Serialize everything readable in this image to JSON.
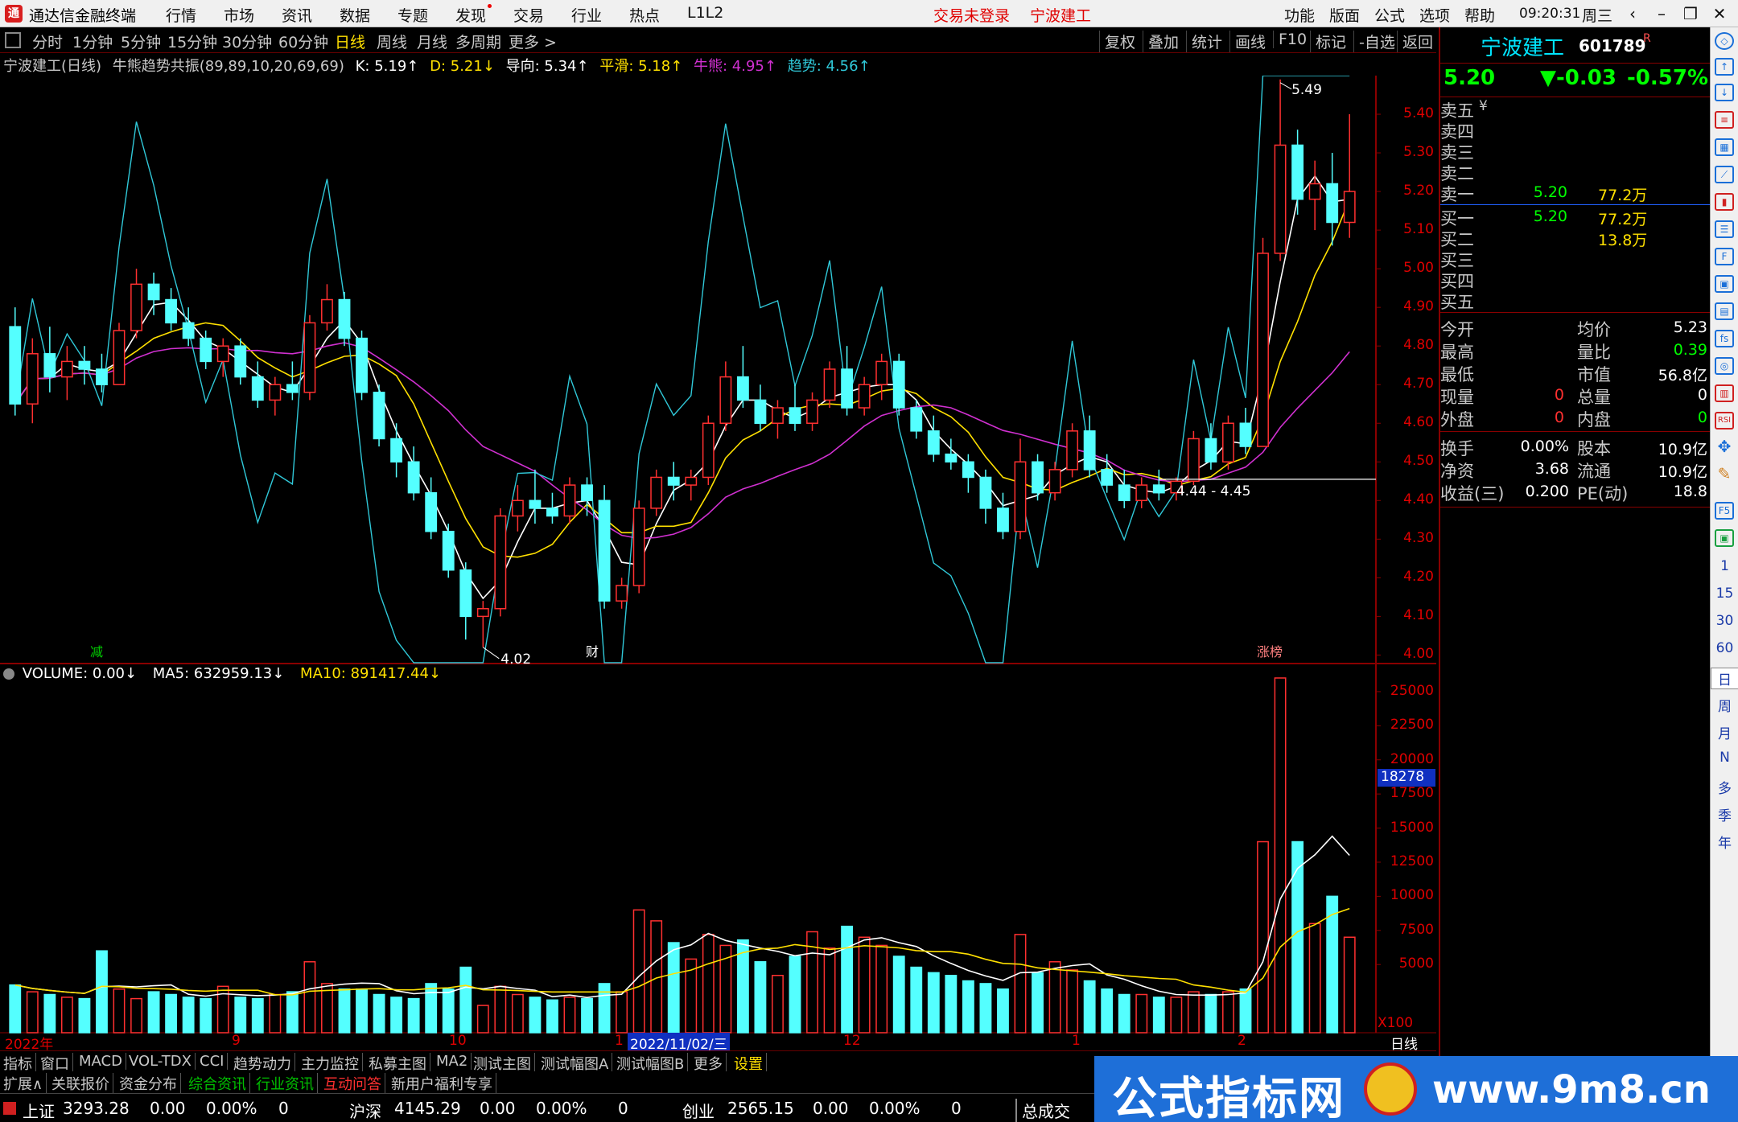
{
  "app": {
    "name": "通达信金融终端",
    "menu": [
      "行情",
      "市场",
      "资讯",
      "数据",
      "专题",
      "发现",
      "交易",
      "行业",
      "热点",
      "L1L2"
    ],
    "login_status": "交易未登录",
    "stock_title": "宁波建工",
    "sys_menu": [
      "功能",
      "版面",
      "公式",
      "选项",
      "帮助"
    ],
    "time": "09:20:31",
    "weekday": "周三"
  },
  "periods": [
    "分时",
    "1分钟",
    "5分钟",
    "15分钟",
    "30分钟",
    "60分钟",
    "日线",
    "周线",
    "月线",
    "多周期",
    "更多 >"
  ],
  "active_period": "日线",
  "toolbar": [
    "复权",
    "叠加",
    "统计",
    "画线",
    "F10",
    "标记",
    "-自选",
    "返回"
  ],
  "indicator_line": {
    "stock": "宁波建工(日线)",
    "formula": "牛熊趋势共振(89,89,10,20,69,69)",
    "k": "K: 5.19↑",
    "d": "D: 5.21↓",
    "guide": "导向: 5.34↑",
    "smooth": "平滑: 5.18↑",
    "bullbear": "牛熊: 4.95↑",
    "trend": "趋势: 4.56↑"
  },
  "price_axis": [
    "5.40",
    "5.30",
    "5.20",
    "5.10",
    "5.00",
    "4.90",
    "4.80",
    "4.70",
    "4.60",
    "4.50",
    "4.40",
    "4.30",
    "4.20",
    "4.10",
    "4.00"
  ],
  "annotations": {
    "high": "5.49",
    "low": "4.02",
    "range": "4.44 - 4.45",
    "marker_jian": "减",
    "marker_cai": "财",
    "marker_zhangbang": "涨榜"
  },
  "volume_line": {
    "label": "VOLUME: 0.00↓",
    "ma5": "MA5: 632959.13↓",
    "ma10": "MA10: 891417.44↓"
  },
  "volume_axis": [
    "25000",
    "22500",
    "20000",
    "17500",
    "15000",
    "12500",
    "10000",
    "7500",
    "5000"
  ],
  "volume_cursor": "18278",
  "volume_unit": "X100",
  "date_axis": {
    "labels": [
      "2022年",
      "9",
      "10",
      "1",
      "12",
      "1",
      "2"
    ],
    "cursor": "2022/11/02/三",
    "period_label": "日线"
  },
  "quote": {
    "name": "宁波建工",
    "code": "601789",
    "r_mark": "R",
    "price": "5.20",
    "change": "▼-0.03",
    "change_pct": "-0.57%",
    "asks": [
      {
        "label": "卖五",
        "price": "",
        "vol": "",
        "mark": "¥"
      },
      {
        "label": "卖四",
        "price": "",
        "vol": ""
      },
      {
        "label": "卖三",
        "price": "",
        "vol": ""
      },
      {
        "label": "卖二",
        "price": "",
        "vol": ""
      },
      {
        "label": "卖一",
        "price": "5.20",
        "vol": "77.2万"
      }
    ],
    "bids": [
      {
        "label": "买一",
        "price": "5.20",
        "vol": "77.2万"
      },
      {
        "label": "买二",
        "price": "",
        "vol": "13.8万"
      },
      {
        "label": "买三",
        "price": "",
        "vol": ""
      },
      {
        "label": "买四",
        "price": "",
        "vol": ""
      },
      {
        "label": "买五",
        "price": "",
        "vol": ""
      }
    ],
    "stats_left": [
      {
        "label": "今开",
        "value": ""
      },
      {
        "label": "最高",
        "value": ""
      },
      {
        "label": "最低",
        "value": ""
      },
      {
        "label": "现量",
        "value": "0"
      },
      {
        "label": "外盘",
        "value": "0"
      }
    ],
    "stats_right": [
      {
        "label": "均价",
        "value": "5.23"
      },
      {
        "label": "量比",
        "value": "0.39"
      },
      {
        "label": "市值",
        "value": "56.8亿"
      },
      {
        "label": "总量",
        "value": "0"
      },
      {
        "label": "内盘",
        "value": "0"
      }
    ],
    "fund_left": [
      {
        "label": "换手",
        "value": "0.00%"
      },
      {
        "label": "净资",
        "value": "3.68"
      },
      {
        "label": "收益(三)",
        "value": "0.200"
      }
    ],
    "fund_right": [
      {
        "label": "股本",
        "value": "10.9亿"
      },
      {
        "label": "流通",
        "value": "10.9亿"
      },
      {
        "label": "PE(动)",
        "value": "18.8"
      }
    ]
  },
  "strip_labels": [
    "1",
    "15",
    "30",
    "60",
    "日",
    "周",
    "月",
    "N",
    "多",
    "季",
    "年"
  ],
  "tabs1": [
    "指标",
    "窗口",
    "MACD",
    "VOL-TDX",
    "CCI",
    "趋势动力",
    "主力监控",
    "私募主图",
    "MA2",
    "测试主图",
    "测试幅图A",
    "测试幅图B",
    "更多",
    "设置"
  ],
  "tabs2": [
    "扩展∧",
    "关联报价",
    "资金分布",
    "综合资讯",
    "行业资讯",
    "互动问答",
    "新用户福利专享"
  ],
  "status": {
    "sh_name": "上证",
    "sh_val": "3293.28",
    "sh_chg": "0.00",
    "sh_pct": "0.00%",
    "sh_vol": "0",
    "hs_name": "沪深",
    "hs_val": "4145.29",
    "hs_chg": "0.00",
    "hs_pct": "0.00%",
    "hs_vol": "0",
    "cy_name": "创业",
    "cy_val": "2565.15",
    "cy_chg": "0.00",
    "cy_pct": "0.00%",
    "cy_vol": "0",
    "total": "总成交"
  },
  "watermark": {
    "text": "公式指标网",
    "url": "www.9m8.cn"
  },
  "colors": {
    "up": "#ff3030",
    "down": "#54ffff",
    "axis_red": "#e00000",
    "k_line": "#ffffff",
    "d_line": "#ffe000",
    "bullbear": "#d030d0",
    "trend": "#30c8d8"
  },
  "chart_data": {
    "type": "candlestick",
    "ylim": [
      3.98,
      5.5
    ],
    "candles_ohlc": [
      [
        4.85,
        4.9,
        4.62,
        4.65
      ],
      [
        4.65,
        4.82,
        4.6,
        4.78
      ],
      [
        4.78,
        4.85,
        4.68,
        4.72
      ],
      [
        4.72,
        4.8,
        4.66,
        4.76
      ],
      [
        4.76,
        4.8,
        4.7,
        4.74
      ],
      [
        4.74,
        4.78,
        4.68,
        4.7
      ],
      [
        4.7,
        4.86,
        4.7,
        4.84
      ],
      [
        4.84,
        5.0,
        4.82,
        4.96
      ],
      [
        4.96,
        4.99,
        4.88,
        4.92
      ],
      [
        4.92,
        4.95,
        4.84,
        4.86
      ],
      [
        4.86,
        4.9,
        4.8,
        4.82
      ],
      [
        4.82,
        4.84,
        4.74,
        4.76
      ],
      [
        4.76,
        4.82,
        4.72,
        4.8
      ],
      [
        4.8,
        4.82,
        4.7,
        4.72
      ],
      [
        4.72,
        4.76,
        4.64,
        4.66
      ],
      [
        4.66,
        4.72,
        4.62,
        4.7
      ],
      [
        4.7,
        4.76,
        4.66,
        4.68
      ],
      [
        4.68,
        4.88,
        4.66,
        4.86
      ],
      [
        4.86,
        4.96,
        4.84,
        4.92
      ],
      [
        4.92,
        4.94,
        4.8,
        4.82
      ],
      [
        4.82,
        4.84,
        4.66,
        4.68
      ],
      [
        4.68,
        4.7,
        4.54,
        4.56
      ],
      [
        4.56,
        4.6,
        4.46,
        4.5
      ],
      [
        4.5,
        4.54,
        4.4,
        4.42
      ],
      [
        4.42,
        4.46,
        4.3,
        4.32
      ],
      [
        4.32,
        4.34,
        4.2,
        4.22
      ],
      [
        4.22,
        4.24,
        4.04,
        4.1
      ],
      [
        4.1,
        4.14,
        4.02,
        4.12
      ],
      [
        4.12,
        4.38,
        4.1,
        4.36
      ],
      [
        4.36,
        4.44,
        4.32,
        4.4
      ],
      [
        4.4,
        4.48,
        4.34,
        4.38
      ],
      [
        4.38,
        4.42,
        4.34,
        4.36
      ],
      [
        4.36,
        4.46,
        4.34,
        4.44
      ],
      [
        4.44,
        4.46,
        4.36,
        4.4
      ],
      [
        4.4,
        4.44,
        4.12,
        4.14
      ],
      [
        4.14,
        4.2,
        4.12,
        4.18
      ],
      [
        4.18,
        4.4,
        4.16,
        4.38
      ],
      [
        4.38,
        4.48,
        4.36,
        4.46
      ],
      [
        4.46,
        4.5,
        4.4,
        4.44
      ],
      [
        4.44,
        4.48,
        4.4,
        4.46
      ],
      [
        4.46,
        4.62,
        4.44,
        4.6
      ],
      [
        4.6,
        4.76,
        4.58,
        4.72
      ],
      [
        4.72,
        4.8,
        4.64,
        4.66
      ],
      [
        4.66,
        4.7,
        4.58,
        4.6
      ],
      [
        4.6,
        4.66,
        4.56,
        4.64
      ],
      [
        4.64,
        4.7,
        4.58,
        4.6
      ],
      [
        4.6,
        4.68,
        4.58,
        4.66
      ],
      [
        4.66,
        4.76,
        4.64,
        4.74
      ],
      [
        4.74,
        4.8,
        4.62,
        4.64
      ],
      [
        4.64,
        4.72,
        4.62,
        4.7
      ],
      [
        4.7,
        4.78,
        4.66,
        4.76
      ],
      [
        4.76,
        4.78,
        4.62,
        4.64
      ],
      [
        4.64,
        4.66,
        4.56,
        4.58
      ],
      [
        4.58,
        4.62,
        4.5,
        4.52
      ],
      [
        4.52,
        4.56,
        4.48,
        4.5
      ],
      [
        4.5,
        4.52,
        4.42,
        4.46
      ],
      [
        4.46,
        4.48,
        4.34,
        4.38
      ],
      [
        4.38,
        4.42,
        4.3,
        4.32
      ],
      [
        4.32,
        4.56,
        4.3,
        4.5
      ],
      [
        4.5,
        4.52,
        4.4,
        4.42
      ],
      [
        4.42,
        4.5,
        4.4,
        4.48
      ],
      [
        4.48,
        4.6,
        4.46,
        4.58
      ],
      [
        4.58,
        4.62,
        4.46,
        4.48
      ],
      [
        4.48,
        4.52,
        4.42,
        4.44
      ],
      [
        4.44,
        4.48,
        4.38,
        4.4
      ],
      [
        4.4,
        4.46,
        4.38,
        4.44
      ],
      [
        4.44,
        4.48,
        4.4,
        4.42
      ],
      [
        4.42,
        4.46,
        4.4,
        4.45
      ],
      [
        4.45,
        4.58,
        4.44,
        4.56
      ],
      [
        4.56,
        4.6,
        4.48,
        4.5
      ],
      [
        4.5,
        4.62,
        4.48,
        4.6
      ],
      [
        4.6,
        4.64,
        4.52,
        4.54
      ],
      [
        4.54,
        5.08,
        4.54,
        5.04
      ],
      [
        5.04,
        5.49,
        5.02,
        5.32
      ],
      [
        5.32,
        5.36,
        5.14,
        5.18
      ],
      [
        5.18,
        5.28,
        5.1,
        5.22
      ],
      [
        5.22,
        5.3,
        5.06,
        5.12
      ],
      [
        5.12,
        5.4,
        5.08,
        5.2
      ]
    ],
    "volume_axis_range": [
      0,
      27000
    ],
    "volume_series": [
      3500,
      3000,
      2800,
      2600,
      2500,
      6000,
      3200,
      2500,
      3000,
      2800,
      2600,
      2500,
      3400,
      2600,
      2500,
      2800,
      3000,
      5200,
      3600,
      3200,
      3200,
      2800,
      2600,
      2500,
      3600,
      3200,
      4800,
      2000,
      3400,
      2800,
      2600,
      2400,
      2600,
      2500,
      3600,
      3000,
      9000,
      8200,
      6600,
      5400,
      7200,
      6400,
      6800,
      5200,
      4200,
      5600,
      7400,
      6200,
      7800,
      7000,
      6400,
      5600,
      4800,
      4400,
      4200,
      3800,
      3600,
      3200,
      7200,
      4400,
      5200,
      4600,
      3800,
      3200,
      2800,
      2800,
      2600,
      2600,
      3000,
      2800,
      3000,
      3200,
      14000,
      26000,
      14000,
      8000,
      10000,
      7000
    ]
  }
}
